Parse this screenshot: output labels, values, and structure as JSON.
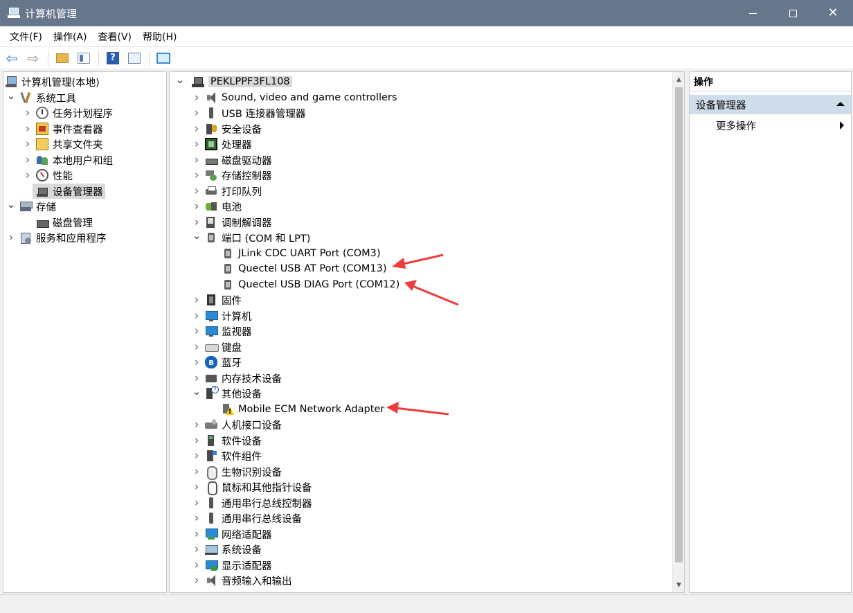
{
  "window": {
    "title": "计算机管理",
    "controls": {
      "minimize": "minimize-icon",
      "maximize": "maximize-icon",
      "close": "close-icon"
    }
  },
  "menu": [
    "文件(F)",
    "操作(A)",
    "查看(V)",
    "帮助(H)"
  ],
  "toolbar": {
    "icons": [
      "back-arrow-icon",
      "forward-arrow-icon",
      "up-folder-icon",
      "show-hide-tree-icon",
      "help-icon",
      "properties-icon",
      "connect-computer-icon"
    ],
    "help_glyph": "?"
  },
  "left_tree": {
    "root": "计算机管理(本地)",
    "system_tools": "系统工具",
    "task_scheduler": "任务计划程序",
    "event_viewer": "事件查看器",
    "shared_folders": "共享文件夹",
    "local_users": "本地用户和组",
    "performance": "性能",
    "device_manager": "设备管理器",
    "storage": "存储",
    "disk_management": "磁盘管理",
    "services": "服务和应用程序"
  },
  "devices": {
    "computer_name": "PEKLPPF3FL108",
    "categories": [
      "Sound, video and game controllers",
      "USB 连接器管理器",
      "安全设备",
      "处理器",
      "磁盘驱动器",
      "存储控制器",
      "打印队列",
      "电池",
      "调制解调器",
      "端口 (COM 和 LPT)",
      "JLink CDC UART Port (COM3)",
      "Quectel USB AT Port (COM13)",
      "Quectel USB DIAG Port (COM12)",
      "固件",
      "计算机",
      "监视器",
      "键盘",
      "蓝牙",
      "内存技术设备",
      "其他设备",
      "Mobile ECM Network Adapter",
      "人机接口设备",
      "软件设备",
      "软件组件",
      "生物识别设备",
      "鼠标和其他指针设备",
      "通用串行总线控制器",
      "通用串行总线设备",
      "网络适配器",
      "系统设备",
      "显示适配器",
      "音频输入和输出"
    ],
    "bluetooth_glyph": "ʙ"
  },
  "actions": {
    "title": "操作",
    "section": "设备管理器",
    "more": "更多操作"
  },
  "colors": {
    "titlebar": "#66778b",
    "selection": "#d9d9d9",
    "actions_header": "#cfdce9",
    "annotation_arrow": "#ee3b3b"
  }
}
